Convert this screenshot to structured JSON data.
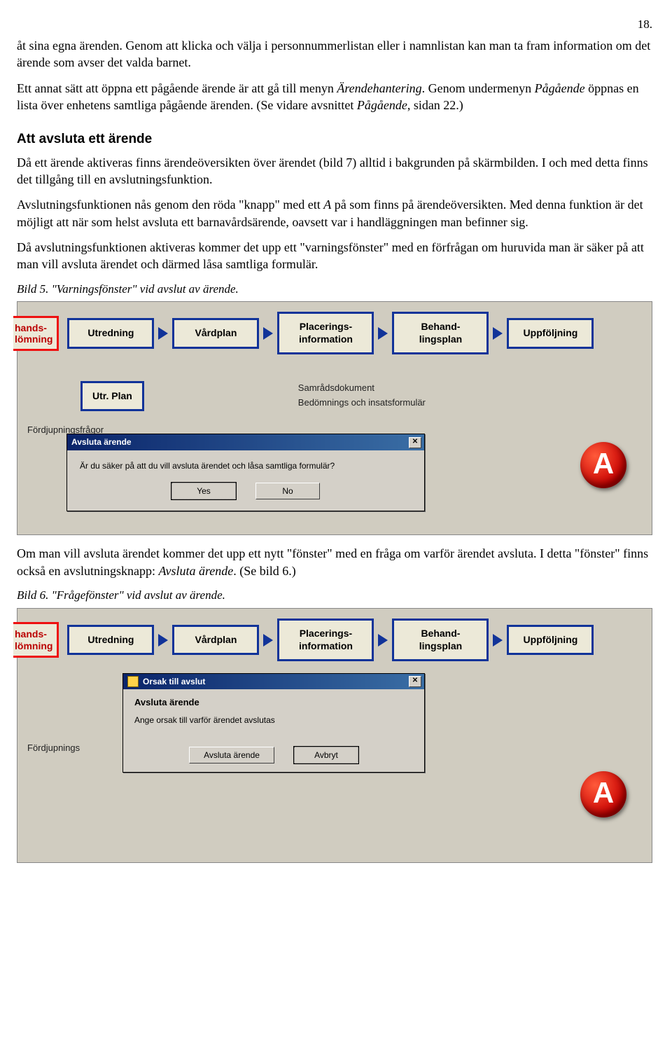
{
  "page_number": "18.",
  "para1": "åt sina egna ärenden. Genom att klicka och välja i personnummerlistan eller i namnlistan kan man ta fram information om det ärende som avser det valda barnet.",
  "para2_a": "Ett annat sätt att öppna ett pågående ärende är att gå till menyn ",
  "para2_i1": "Ärendehantering",
  "para2_b": ". Genom undermenyn ",
  "para2_i2": "Pågående",
  "para2_c": " öppnas en lista över enhetens samtliga pågående ärenden. (Se vidare avsnittet ",
  "para2_i3": "Pågående",
  "para2_d": ", sidan 22.)",
  "heading": "Att avsluta ett ärende",
  "para3": "Då ett ärende aktiveras finns ärendeöversikten över ärendet (bild 7) alltid i bakgrunden på skärmbilden. I och med detta finns det tillgång till en avslutningsfunktion.",
  "para4_a": "Avslutningsfunktionen nås genom den röda \"knapp\" med ett ",
  "para4_i1": "A",
  "para4_b": " på som finns på ärendeöversikten. Med denna funktion är det möjligt att när som helst avsluta ett barnavårdsärende, oavsett var i handläggningen man befinner sig.",
  "para5": "Då avslutningsfunktionen aktiveras kommer det upp ett \"varningsfönster\" med en förfrågan om huruvida man är säker på att man vill avsluta ärendet och därmed låsa samtliga formulär.",
  "caption5": "Bild 5. \"Varningsfönster\" vid avslut av ärende.",
  "flow": {
    "cutleft_l1": "hands-",
    "cutleft_l2": "lömning",
    "b1": "Utredning",
    "b2": "Vårdplan",
    "b3_l1": "Placerings-",
    "b3_l2": "information",
    "b4_l1": "Behand-",
    "b4_l2": "lingsplan",
    "b5": "Uppföljning",
    "utrplan": "Utr. Plan",
    "side_l1": "Samrådsdokument",
    "side_l2": "Bedömnings och insatsformulär",
    "fordjup1": "Fördjupningsfrågor",
    "fordjup2": "Fördjupnings"
  },
  "dialog1": {
    "title": "Avsluta ärende",
    "msg": "Är du säker på att du vill avsluta ärendet och låsa samtliga formulär?",
    "yes": "Yes",
    "no": "No"
  },
  "red_a": "A",
  "para6_a": "Om man vill avsluta ärendet kommer det upp ett nytt \"fönster\" med en fråga om varför ärendet avsluta. I detta \"fönster\" finns också en avslutningsknapp: ",
  "para6_i1": "Avsluta ärende",
  "para6_b": ". (Se bild 6.)",
  "caption6": "Bild 6. \"Frågefönster\" vid avslut av ärende.",
  "dialog2": {
    "title": "Orsak till avslut",
    "h": "Avsluta ärende",
    "sub": "Ange orsak till varför ärendet avslutas",
    "ok": "Avsluta ärende",
    "cancel": "Avbryt"
  }
}
